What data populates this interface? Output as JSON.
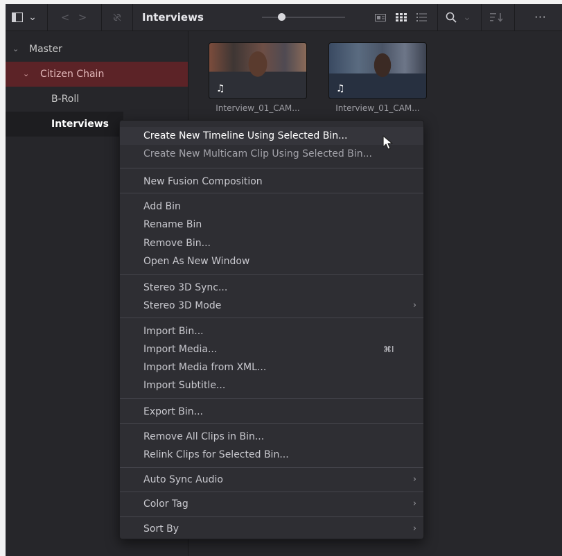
{
  "toolbar": {
    "title": "Interviews",
    "icons": {
      "panel_toggle": "sidebar-panel-icon",
      "chevron": "chevron-down-icon",
      "back": "back-icon",
      "forward": "forward-icon",
      "link": "link-icon",
      "metadata_view": "metadata-view-icon",
      "thumbnail_view": "thumbnail-view-icon",
      "list_view": "list-view-icon",
      "search": "search-icon",
      "sort": "sort-icon",
      "more": "more-icon"
    },
    "chevron_glyph": "⌄",
    "back_glyph": "<",
    "forward_glyph": ">",
    "more_glyph": "···"
  },
  "sidebar": {
    "items": [
      {
        "label": "Master",
        "chevron": "⌄"
      },
      {
        "label": "Citizen Chain",
        "chevron": "⌄"
      },
      {
        "label": "B-Roll"
      },
      {
        "label": "Interviews"
      }
    ]
  },
  "clips": [
    {
      "name": "Interview_01_CAM...",
      "music_glyph": "♫"
    },
    {
      "name": "Interview_01_CAM...",
      "music_glyph": "♫"
    }
  ],
  "menu": {
    "groups": [
      {
        "items": [
          {
            "label": "Create New Timeline Using Selected Bin..."
          },
          {
            "label": "Create New Multicam Clip Using Selected Bin..."
          }
        ]
      },
      {
        "items": [
          {
            "label": "New Fusion Composition"
          }
        ]
      },
      {
        "items": [
          {
            "label": "Add Bin"
          },
          {
            "label": "Rename Bin"
          },
          {
            "label": "Remove Bin..."
          },
          {
            "label": "Open As New Window"
          }
        ]
      },
      {
        "items": [
          {
            "label": "Stereo 3D Sync..."
          },
          {
            "label": "Stereo 3D Mode",
            "submenu": "›"
          }
        ]
      },
      {
        "items": [
          {
            "label": "Import Bin..."
          },
          {
            "label": "Import Media...",
            "shortcut": "⌘I"
          },
          {
            "label": "Import Media from XML..."
          },
          {
            "label": "Import Subtitle..."
          }
        ]
      },
      {
        "items": [
          {
            "label": "Export Bin..."
          }
        ]
      },
      {
        "items": [
          {
            "label": "Remove All Clips in Bin..."
          },
          {
            "label": "Relink Clips for Selected Bin..."
          }
        ]
      },
      {
        "items": [
          {
            "label": "Auto Sync Audio",
            "submenu": "›"
          }
        ]
      },
      {
        "items": [
          {
            "label": "Color Tag",
            "submenu": "›"
          }
        ]
      },
      {
        "items": [
          {
            "label": "Sort By",
            "submenu": "›"
          }
        ]
      }
    ]
  },
  "colors": {
    "selected_bin": "#5c2327",
    "panel_bg": "#27272b",
    "menu_bg": "#2e2e33"
  }
}
